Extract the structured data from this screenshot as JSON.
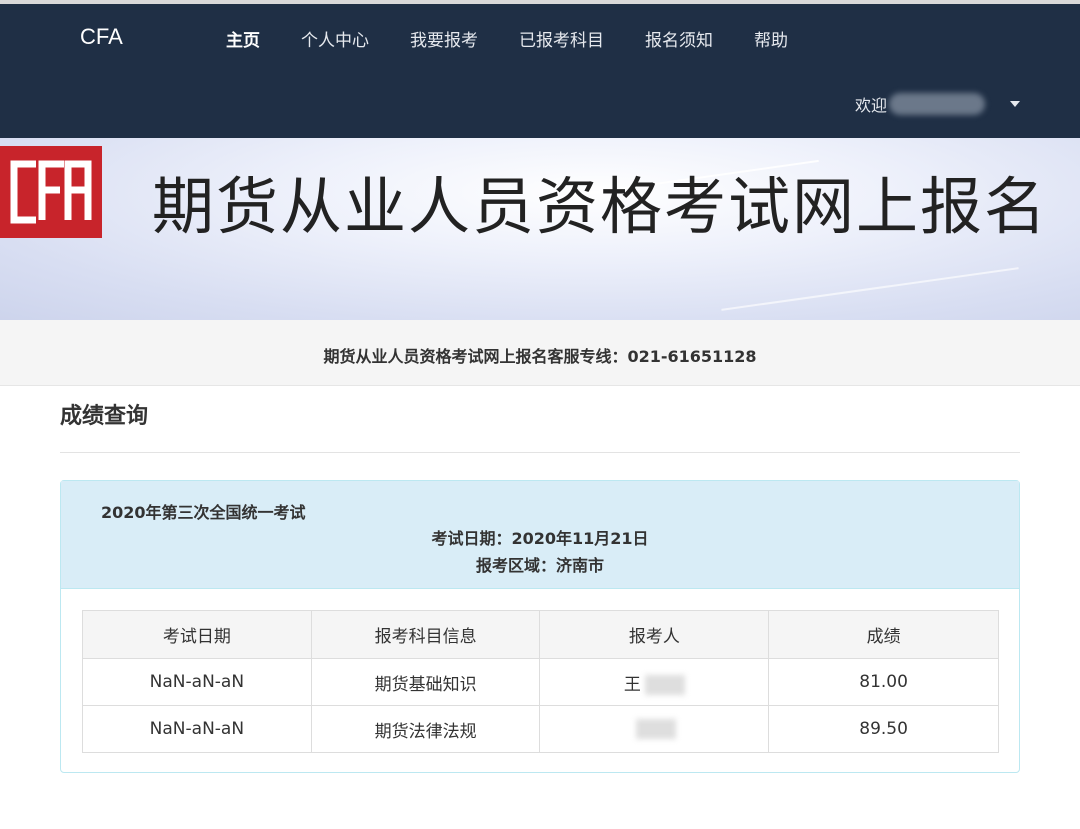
{
  "navbar": {
    "brand": "CFA",
    "items": [
      {
        "label": "主页",
        "active": true
      },
      {
        "label": "个人中心",
        "active": false
      },
      {
        "label": "我要报考",
        "active": false
      },
      {
        "label": "已报考科目",
        "active": false
      },
      {
        "label": "报名须知",
        "active": false
      },
      {
        "label": "帮助",
        "active": false
      }
    ],
    "welcome": "欢迎"
  },
  "banner": {
    "logo_text": "CFA",
    "title": "期货从业人员资格考试网上报名"
  },
  "hotline": "期货从业人员资格考试网上报名客服专线：021-61651128",
  "page_title": "成绩查询",
  "exam": {
    "name": "2020年第三次全国统一考试",
    "date": "考试日期：2020年11月21日",
    "region": "报考区域：济南市"
  },
  "table": {
    "headers": [
      "考试日期",
      "报考科目信息",
      "报考人",
      "成绩"
    ],
    "rows": [
      [
        "NaN-aN-aN",
        "期货基础知识",
        "王",
        "81.00"
      ],
      [
        "NaN-aN-aN",
        "期货法律法规",
        "",
        "89.50"
      ]
    ]
  },
  "colors": {
    "navbar_bg": "#1f2f45",
    "logo_red": "#c8242b",
    "panel_head": "#d9edf7"
  }
}
